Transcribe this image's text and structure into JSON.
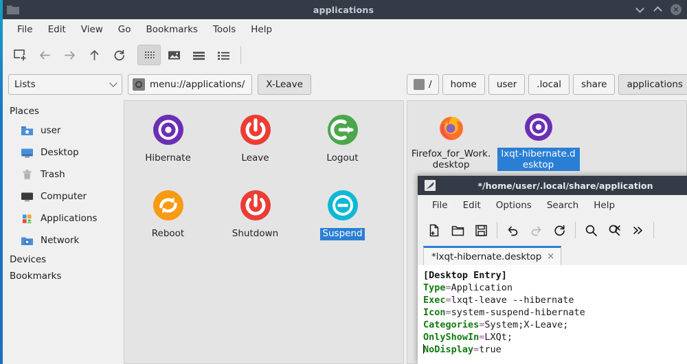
{
  "file_manager": {
    "title": "applications",
    "titlebar_icon": "folder-icon",
    "window_buttons": [
      {
        "name": "minimize-button",
        "glyph": "chevron-down-icon"
      },
      {
        "name": "maximize-button",
        "glyph": "chevron-up-icon"
      },
      {
        "name": "close-button",
        "glyph": "close-icon",
        "label": "×"
      }
    ],
    "menus": [
      "File",
      "Edit",
      "View",
      "Go",
      "Bookmarks",
      "Tools",
      "Help"
    ],
    "toolbar": [
      {
        "name": "new-tab-button",
        "icon": "new-window-icon"
      },
      {
        "name": "back-button",
        "icon": "arrow-left-icon"
      },
      {
        "name": "forward-button",
        "icon": "arrow-right-icon"
      },
      {
        "name": "up-button",
        "icon": "arrow-up-icon"
      },
      {
        "name": "reload-button",
        "icon": "reload-icon"
      },
      {
        "name": "view-grid-button",
        "icon": "grid-view-icon",
        "active": true
      },
      {
        "name": "view-thumbnail-button",
        "icon": "thumbnail-view-icon"
      },
      {
        "name": "view-compact-button",
        "icon": "compact-view-icon"
      },
      {
        "name": "view-detail-button",
        "icon": "detail-view-icon"
      }
    ],
    "view_selector": {
      "value": "Lists"
    },
    "path_bar": {
      "value": "menu://applications/",
      "icon": "menu-location-icon"
    },
    "left_crumbs": [
      "X-Leave"
    ],
    "right_crumbs": [
      {
        "label": "/",
        "icon": "root-icon",
        "active": false
      },
      {
        "label": "home",
        "active": false
      },
      {
        "label": "user",
        "active": false
      },
      {
        "label": ".local",
        "active": false
      },
      {
        "label": "share",
        "active": false
      },
      {
        "label": "applications",
        "active": true
      }
    ],
    "sidebar": {
      "sections": [
        {
          "title": "Places",
          "items": [
            {
              "label": "user",
              "icon": "home-folder-icon"
            },
            {
              "label": "Desktop",
              "icon": "desktop-icon"
            },
            {
              "label": "Trash",
              "icon": "trash-icon"
            },
            {
              "label": "Computer",
              "icon": "computer-icon"
            },
            {
              "label": "Applications",
              "icon": "applications-icon"
            },
            {
              "label": "Network",
              "icon": "network-icon"
            }
          ]
        },
        {
          "title": "Devices",
          "items": []
        },
        {
          "title": "Bookmarks",
          "items": []
        }
      ]
    },
    "center_pane": {
      "items": [
        {
          "label": "Hibernate",
          "icon": "hibernate-icon",
          "color": "#6a2fb5",
          "selected": false
        },
        {
          "label": "Leave",
          "icon": "power-icon",
          "color": "#ea3d36",
          "selected": false
        },
        {
          "label": "Logout",
          "icon": "logout-icon",
          "color": "#4ca64c",
          "selected": false
        },
        {
          "label": "Reboot",
          "icon": "reboot-icon",
          "color": "#f79a14",
          "selected": false
        },
        {
          "label": "Shutdown",
          "icon": "power-icon",
          "color": "#ea3d36",
          "selected": false
        },
        {
          "label": "Suspend",
          "icon": "suspend-icon",
          "color": "#0fb8d4",
          "selected": true
        }
      ]
    },
    "right_pane": {
      "items": [
        {
          "label": "Firefox_for_Work.desktop",
          "icon": "firefox-icon",
          "selected": false
        },
        {
          "label": "lxqt-hibernate.desktop",
          "icon": "hibernate-icon",
          "selected": true
        }
      ]
    },
    "colors": {
      "selection": "#2a7fd4",
      "titlebar": "#343a46",
      "accent": "#1a9fc4"
    }
  },
  "editor": {
    "title": "*/home/user/.local/share/application",
    "titlebar_icon": "featherpad-icon",
    "menus": [
      "File",
      "Edit",
      "Options",
      "Search",
      "Help"
    ],
    "toolbar": [
      {
        "name": "new-file-button",
        "icon": "new-file-icon"
      },
      {
        "name": "open-file-button",
        "icon": "open-folder-icon"
      },
      {
        "name": "save-file-button",
        "icon": "save-disk-icon"
      },
      {
        "name": "undo-button",
        "icon": "undo-icon"
      },
      {
        "name": "redo-button",
        "icon": "redo-icon",
        "disabled": true
      },
      {
        "name": "reload-button",
        "icon": "reload-icon"
      },
      {
        "name": "find-button",
        "icon": "search-icon"
      },
      {
        "name": "replace-button",
        "icon": "find-replace-icon"
      },
      {
        "name": "more-button",
        "icon": "chevron-double-right-icon"
      }
    ],
    "tabs": [
      {
        "label": "*lxqt-hibernate.desktop",
        "close": "×",
        "active": true
      }
    ],
    "document": {
      "lines": [
        {
          "key": "[Desktop Entry]",
          "type": "section"
        },
        {
          "key": "Type",
          "value": "Application"
        },
        {
          "key": "Exec",
          "value": "lxqt-leave --hibernate"
        },
        {
          "key": "Icon",
          "value": "system-suspend-hibernate"
        },
        {
          "key": "Categories",
          "value": "System;X-Leave;"
        },
        {
          "key": "OnlyShowIn",
          "value": "LXQt;"
        },
        {
          "key": "NoDisplay",
          "value": "true",
          "caret": true
        }
      ]
    }
  }
}
